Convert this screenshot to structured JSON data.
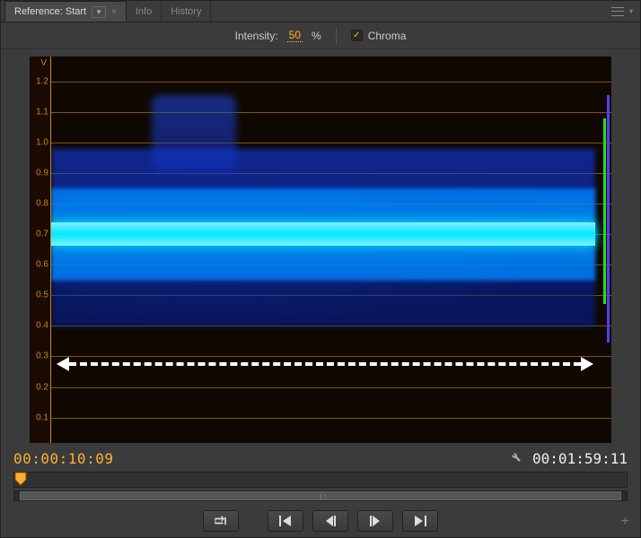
{
  "tabs": {
    "active_label": "Reference: Start",
    "inactive": [
      "Info",
      "History"
    ]
  },
  "options": {
    "intensity_label": "Intensity:",
    "intensity_value": "50",
    "intensity_unit": "%",
    "chroma_label": "Chroma",
    "chroma_checked": true
  },
  "scope": {
    "axis_title": "V",
    "y_ticks": [
      "1.2",
      "1.1",
      "1.0",
      "0.9",
      "0.8",
      "0.7",
      "0.6",
      "0.5",
      "0.4",
      "0.3",
      "0.2",
      "0.1"
    ],
    "colors": {
      "gridline": "#cc8800",
      "waveform_core": "#00e8ff",
      "waveform_glow": "#1040ff"
    }
  },
  "timecode": {
    "current": "00:00:10:09",
    "duration": "00:01:59:11"
  },
  "transport": {
    "loop_label": "loop",
    "goto_in_label": "go-to-in",
    "step_back_label": "step-back",
    "step_fwd_label": "step-forward",
    "goto_out_label": "go-to-out"
  },
  "icons": {
    "wrench": "wrench-icon",
    "add": "add-icon"
  }
}
